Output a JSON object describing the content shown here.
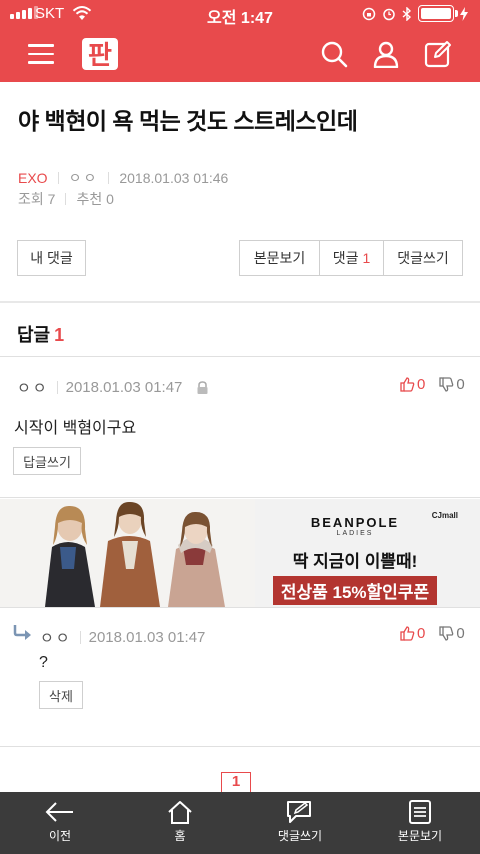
{
  "status": {
    "carrier": "SKT",
    "time": "오전 1:47"
  },
  "header": {
    "logo": "판"
  },
  "post": {
    "title": "야 백현이 욕 먹는 것도 스트레스인데",
    "category": "EXO",
    "author": "ㅇㅇ",
    "datetime": "2018.01.03 01:46",
    "views_label": "조회 7",
    "recommend_label": "추천 0"
  },
  "buttons": {
    "my_comments": "내 댓글",
    "view_post": "본문보기",
    "comments": "댓글",
    "comments_count": "1",
    "write_comment": "댓글쓰기"
  },
  "replies": {
    "heading": "답글",
    "count": "1"
  },
  "comment1": {
    "author": "ㅇㅇ",
    "datetime": "2018.01.03 01:47",
    "up": "0",
    "down": "0",
    "body": "시작이 백혐이구요",
    "reply_button": "답글쓰기"
  },
  "ad": {
    "brand": "BEANPOLE",
    "brand_sub": "LADIES",
    "partner": "CJmall",
    "line1": "딱 지금이 이쁠때!",
    "line2": "전상품 15%할인쿠폰"
  },
  "comment2": {
    "author": "ㅇㅇ",
    "datetime": "2018.01.03 01:47",
    "up": "0",
    "down": "0",
    "body": "?",
    "delete_button": "삭제"
  },
  "pagination": {
    "current": "1"
  },
  "tabbar": {
    "prev": "이전",
    "home": "홈",
    "write_comment": "댓글쓰기",
    "view_post": "본문보기"
  },
  "colors": {
    "accent": "#e84a4c",
    "tabbar": "#3b3b3b"
  }
}
